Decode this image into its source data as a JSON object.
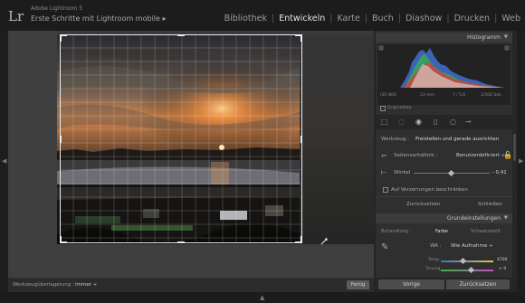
{
  "app": {
    "logo_text": "Lr",
    "product": "Adobe Lightroom 5",
    "catalog": "Erste Schritte mit Lightroom mobile ▸"
  },
  "modules": [
    "Bibliothek",
    "Entwickeln",
    "Karte",
    "Buch",
    "Diashow",
    "Drucken",
    "Web"
  ],
  "active_module": "Entwickeln",
  "toolbar": {
    "overlay_label": "Werkzeugüberlagerung :",
    "overlay_value": "Immer ÷",
    "done_button": "Fertig"
  },
  "histogram": {
    "title": "Histogramm",
    "iso": "ISO 800",
    "focal": "23 mm",
    "aperture": "f / 5,6",
    "shutter": "1/500 Sek.",
    "original_photo": "Originalfoto"
  },
  "tool": {
    "label": "Werkzeug :",
    "name": "Freistellen und gerade ausrichten",
    "aspect_label": "Seitenverhältnis :",
    "aspect_value": "Benutzerdefiniert ÷",
    "angle_label": "Winkel",
    "angle_value": "– 0,41",
    "constrain_label": "Auf Verzerrungen beschränken",
    "reset_button": "Zurücksetzen",
    "close_button": "Schließen"
  },
  "basic": {
    "title": "Grundeinstellungen",
    "treatment_label": "Behandlung :",
    "color_option": "Farbe",
    "bw_option": "Schwarzweiß",
    "wb_label": "WA :",
    "wb_value": "Wie Aufnahme ÷",
    "temp_label": "Temp.",
    "temp_value": "4700",
    "tint_label": "Tönung",
    "tint_value": "+ 9"
  },
  "buttons": {
    "previous": "Vorige",
    "reset": "Zurücksetzen"
  }
}
